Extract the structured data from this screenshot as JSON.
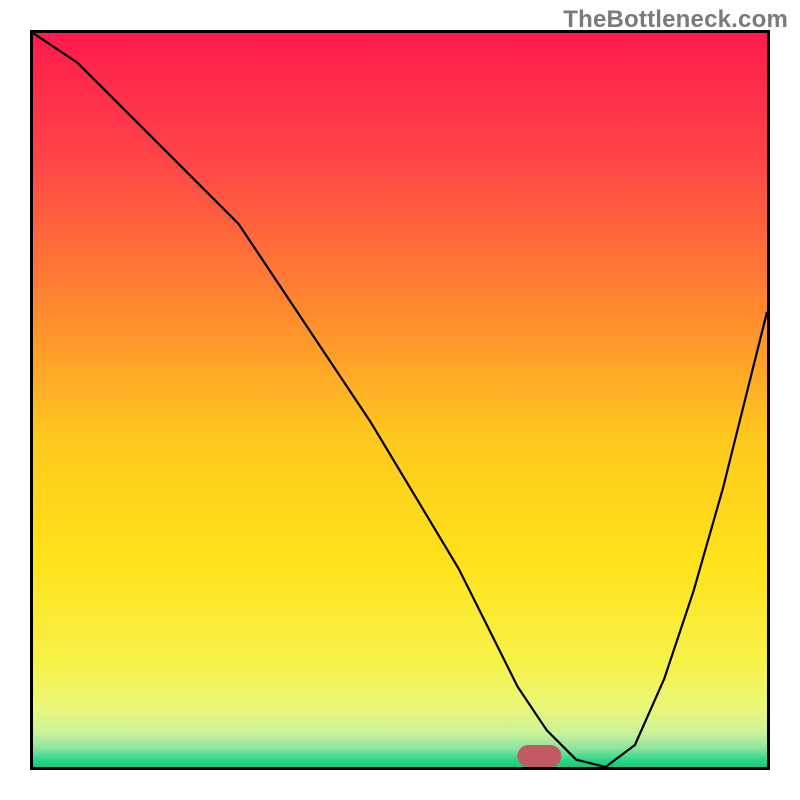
{
  "watermark": "TheBottleneck.com",
  "colors": {
    "border": "#000000",
    "curve": "#000000",
    "marker": "#c25a63",
    "gradient_stops": [
      {
        "offset": 0.0,
        "color": "#ff1a4d"
      },
      {
        "offset": 0.18,
        "color": "#ff4747"
      },
      {
        "offset": 0.38,
        "color": "#ff8a2e"
      },
      {
        "offset": 0.55,
        "color": "#ffc81e"
      },
      {
        "offset": 0.72,
        "color": "#ffe21a"
      },
      {
        "offset": 0.86,
        "color": "#f7f24a"
      },
      {
        "offset": 0.92,
        "color": "#eaf77a"
      },
      {
        "offset": 0.955,
        "color": "#c8f29a"
      },
      {
        "offset": 0.975,
        "color": "#8be3a0"
      },
      {
        "offset": 0.99,
        "color": "#2cd68a"
      },
      {
        "offset": 1.0,
        "color": "#18c87a"
      }
    ]
  },
  "chart_data": {
    "type": "line",
    "title": "",
    "xlabel": "",
    "ylabel": "",
    "xlim": [
      0,
      100
    ],
    "ylim": [
      0,
      100
    ],
    "x": [
      0,
      6,
      14,
      22,
      28,
      34,
      40,
      46,
      52,
      58,
      62,
      66,
      70,
      74,
      78,
      82,
      86,
      90,
      94,
      100
    ],
    "values": [
      100,
      96,
      88,
      80,
      74,
      65,
      56,
      47,
      37,
      27,
      19,
      11,
      5,
      1,
      0,
      3,
      12,
      24,
      38,
      62
    ],
    "marker": {
      "x_center": 69,
      "y_center": 1.5,
      "width": 6,
      "height": 3,
      "rx": 1.5
    },
    "notes": "Axes have no visible tick labels; values are pixel-fraction estimates in [0,100]."
  }
}
